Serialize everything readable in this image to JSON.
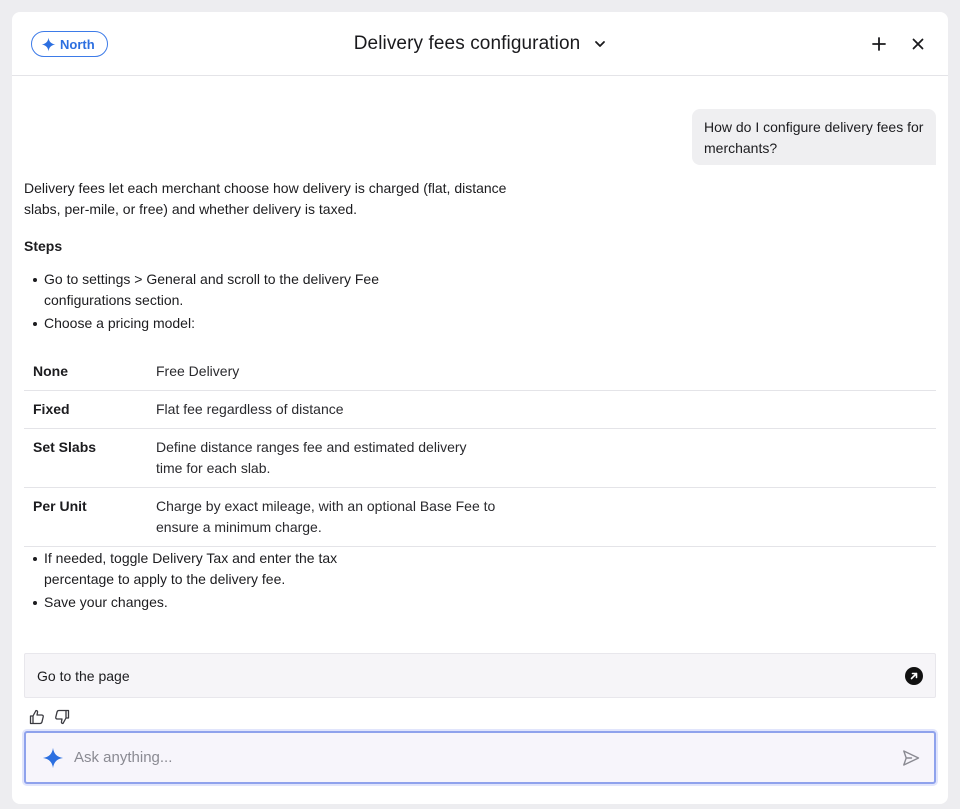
{
  "header": {
    "brand_label": "North",
    "title": "Delivery fees configuration",
    "icons": {
      "brand": "sparkle-icon",
      "title_menu": "chevron-down-icon",
      "new_chat": "plus-icon",
      "close": "close-icon"
    }
  },
  "conversation": {
    "user_message": "How do I configure delivery fees for merchants?",
    "intro": "Delivery fees let each merchant choose how delivery is charged (flat, distance slabs, per-mile, or free) and whether delivery is taxed.",
    "steps_heading": "Steps",
    "steps_before": [
      "Go to settings > General and scroll to the delivery Fee configurations section.",
      "Choose a pricing model:"
    ],
    "pricing_table": [
      {
        "model": "None",
        "description": "Free Delivery"
      },
      {
        "model": "Fixed",
        "description": "Flat fee regardless of distance"
      },
      {
        "model": "Set Slabs",
        "description": "Define distance ranges fee and estimated delivery time for each slab."
      },
      {
        "model": "Per Unit",
        "description": "Charge by exact mileage, with an optional Base Fee to ensure a minimum charge."
      }
    ],
    "steps_after": [
      "If needed, toggle Delivery Tax and enter the tax percentage to apply to the delivery fee.",
      "Save your changes."
    ],
    "goto_label": "Go to the page",
    "icons": {
      "goto": "arrow-up-right-icon",
      "like": "thumbs-up-icon",
      "dislike": "thumbs-down-icon"
    }
  },
  "composer": {
    "placeholder": "Ask anything...",
    "value": "",
    "icons": {
      "leading": "sparkle-icon",
      "send": "send-icon"
    }
  },
  "colors": {
    "accent": "#3d7be8",
    "composer_border": "#8fa2ec",
    "bubble": "#efeff1",
    "page_bg": "#ededf0"
  }
}
